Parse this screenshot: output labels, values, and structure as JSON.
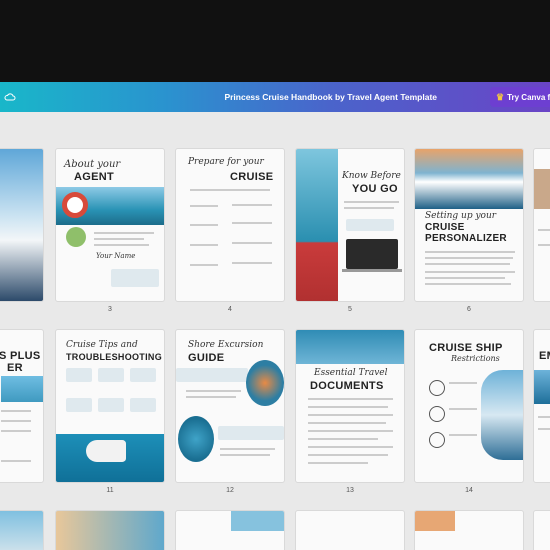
{
  "header": {
    "title": "Princess Cruise Handbook by Travel Agent Template",
    "try_button": "Try Canva f",
    "cloud_icon": "cloud-icon",
    "crown_icon": "crown-icon"
  },
  "pages": {
    "p3": {
      "number": "3",
      "script": "About your",
      "title": "AGENT"
    },
    "p4": {
      "number": "4",
      "script": "Prepare for your",
      "title": "CRUISE"
    },
    "p5": {
      "number": "5",
      "script": "Know Before",
      "title": "YOU GO"
    },
    "p6": {
      "number": "6",
      "script": "Setting up your",
      "title": "CRUISE PERSONALIZER"
    },
    "p10": {
      "title_a": "S PLUS",
      "title_b": "ER"
    },
    "p11": {
      "number": "11",
      "script": "Cruise Tips and",
      "title": "TROUBLESHOOTING"
    },
    "p12": {
      "number": "12",
      "script": "Shore Excursion",
      "title": "GUIDE"
    },
    "p13": {
      "number": "13",
      "script": "Essential Travel",
      "title": "DOCUMENTS"
    },
    "p14": {
      "number": "14",
      "title": "CRUISE SHIP",
      "script": "Restrictions"
    },
    "p15": {
      "title": "EM"
    }
  },
  "colors": {
    "header_start": "#19b7c9",
    "header_end": "#6a44c6",
    "accent": "#5fb8c8"
  }
}
